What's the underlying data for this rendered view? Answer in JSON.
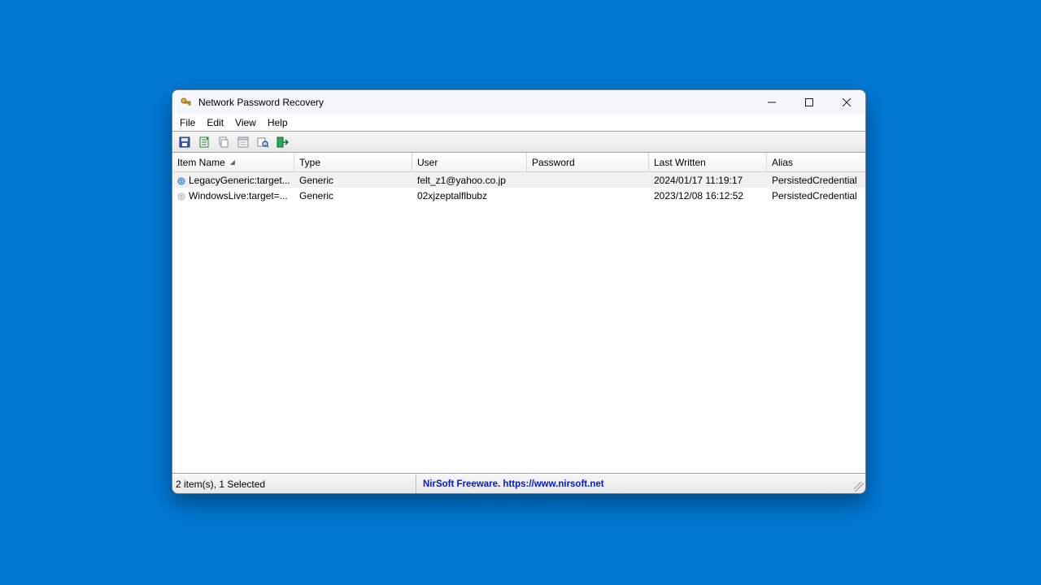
{
  "title": "Network Password Recovery",
  "menu": {
    "file": "File",
    "edit": "Edit",
    "view": "View",
    "help": "Help"
  },
  "toolbar_icons": [
    "save",
    "refresh",
    "copy",
    "properties",
    "find",
    "exit"
  ],
  "columns": {
    "item": "Item Name",
    "type": "Type",
    "user": "User",
    "password": "Password",
    "last": "Last Written",
    "alias": "Alias"
  },
  "sort_column": "item",
  "rows": [
    {
      "item": "LegacyGeneric:target...",
      "type": "Generic",
      "user": "felt_z1@yahoo.co.jp",
      "password": "",
      "last": "2024/01/17 11:19:17",
      "alias": "PersistedCredential",
      "selected": true,
      "icon_color": "#1e6fd8"
    },
    {
      "item": "WindowsLive:target=...",
      "type": "Generic",
      "user": "02xjzeptalflbubz",
      "password": "",
      "last": "2023/12/08 16:12:52",
      "alias": "PersistedCredential",
      "selected": false,
      "icon_color": "#b7b4a7"
    }
  ],
  "status": {
    "left": "2 item(s), 1 Selected",
    "mid": "NirSoft Freeware. https://www.nirsoft.net"
  }
}
